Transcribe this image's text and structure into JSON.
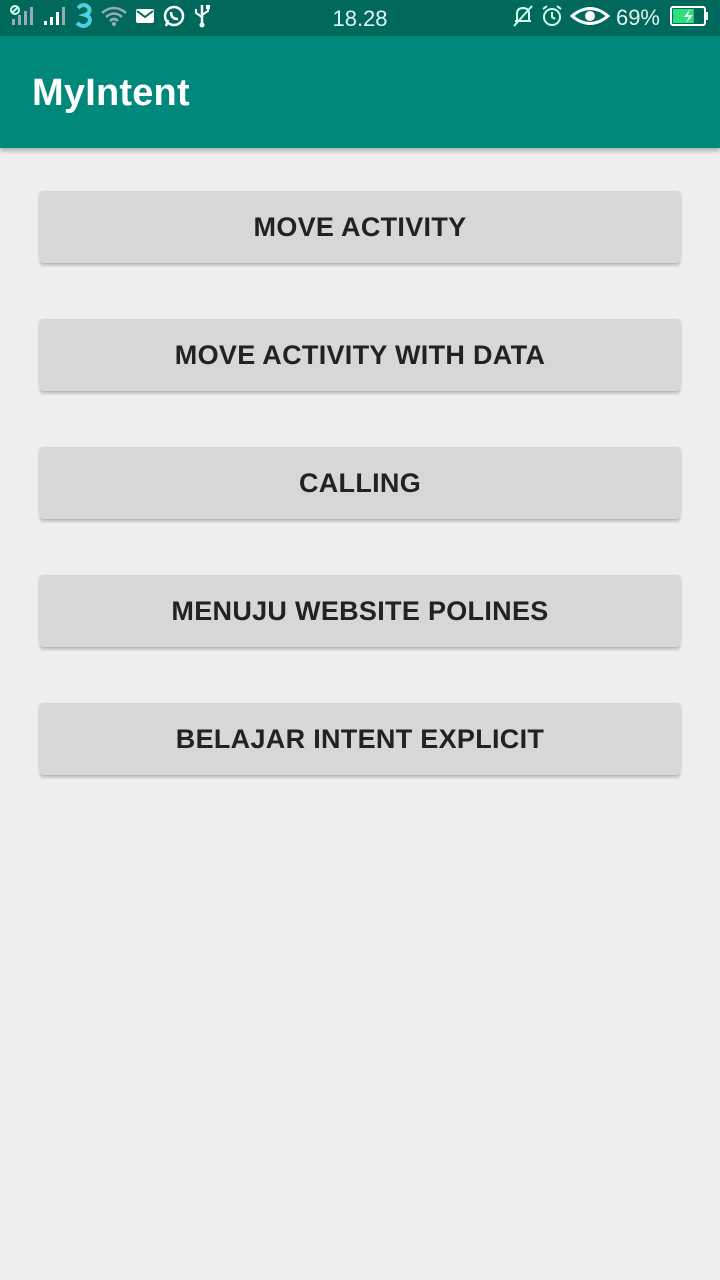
{
  "status_bar": {
    "time": "18.28",
    "battery_percent": "69%",
    "battery_level": 0.69,
    "icons_left": [
      "signal-sim1-icon",
      "signal-sim2-icon",
      "three-carrier-icon",
      "wifi-icon",
      "mail-icon",
      "whatsapp-icon",
      "usb-icon"
    ],
    "icons_right": [
      "notifications-off-icon",
      "alarm-icon",
      "eye-icon",
      "battery-charging-icon"
    ]
  },
  "app_bar": {
    "title": "MyIntent",
    "color": "#00897b",
    "status_color": "#00695c"
  },
  "buttons": [
    {
      "id": "move-activity",
      "label": "MOVE ACTIVITY"
    },
    {
      "id": "move-activity-with-data",
      "label": "MOVE ACTIVITY WITH DATA"
    },
    {
      "id": "calling",
      "label": "CALLING"
    },
    {
      "id": "menuju-website-polines",
      "label": "MENUJU WEBSITE POLINES"
    },
    {
      "id": "belajar-intent-explicit",
      "label": "BELAJAR INTENT EXPLICIT"
    }
  ]
}
